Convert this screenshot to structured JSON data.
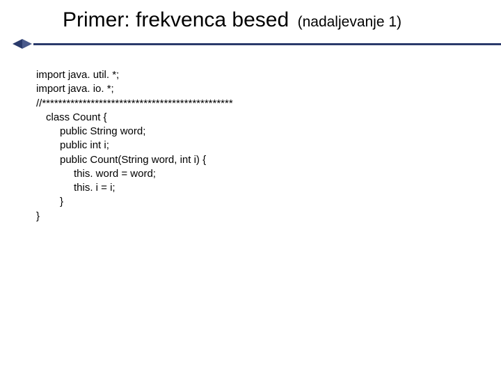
{
  "header": {
    "title": "Primer: frekvenca besed",
    "subtitle": "(nadaljevanje 1)"
  },
  "code": {
    "lines": [
      {
        "text": "import java. util. *;",
        "indent": 0
      },
      {
        "text": "import java. io. *;",
        "indent": 0
      },
      {
        "text": "//***********************************************",
        "indent": 0
      },
      {
        "text": "class Count {",
        "indent": 1
      },
      {
        "text": "public String word;",
        "indent": 2
      },
      {
        "text": "public int i;",
        "indent": 2
      },
      {
        "text": "public Count(String word, int i) {",
        "indent": 2
      },
      {
        "text": "this. word = word;",
        "indent": 3
      },
      {
        "text": "this. i = i;",
        "indent": 3
      },
      {
        "text": "}",
        "indent": 2
      },
      {
        "text": "}",
        "indent": 0
      }
    ]
  }
}
